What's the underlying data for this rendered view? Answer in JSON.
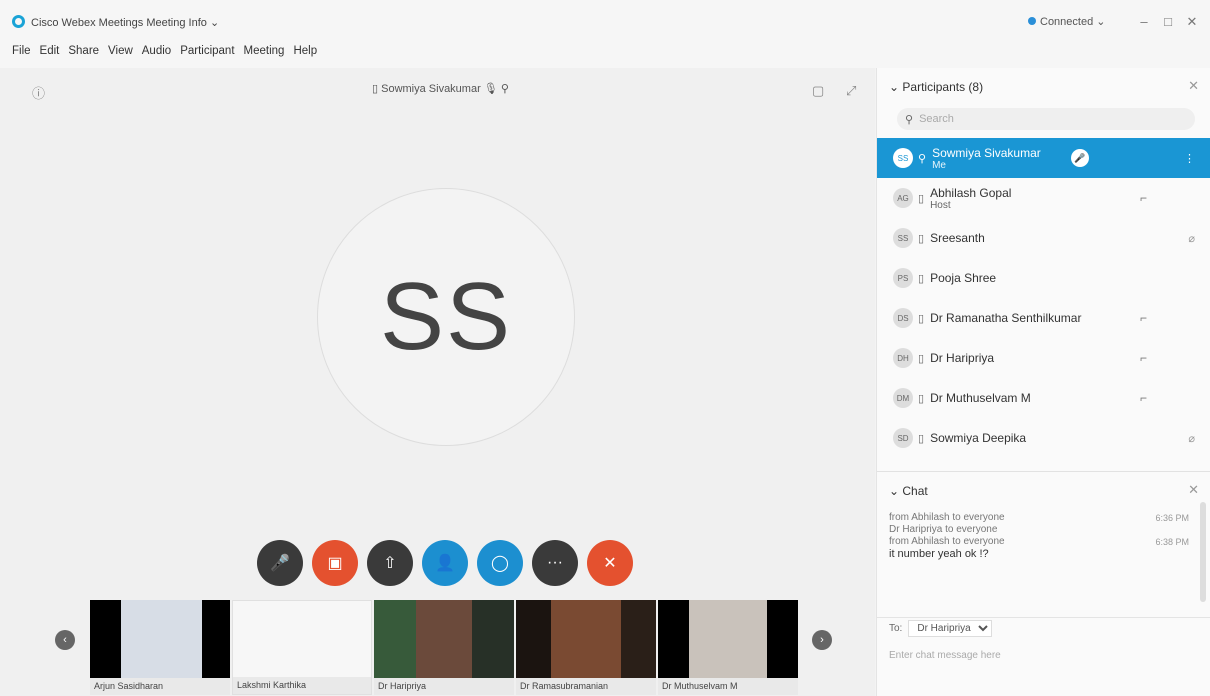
{
  "titlebar": {
    "app_title": "Cisco Webex Meetings    Meeting Info ⌄",
    "connected": "Connected ⌄"
  },
  "menu": [
    "File",
    "Edit",
    "Share",
    "View",
    "Audio",
    "Participant",
    "Meeting",
    "Help"
  ],
  "stage": {
    "speaker_name": "Sowmiya Sivakumar",
    "initials": "SS"
  },
  "controls": [
    {
      "name": "mute",
      "icon": "🎤",
      "color": "dark"
    },
    {
      "name": "stop-video",
      "icon": "■",
      "color": "red"
    },
    {
      "name": "share",
      "icon": "⇧",
      "color": "dark"
    },
    {
      "name": "participants",
      "icon": "👥",
      "color": "blue"
    },
    {
      "name": "chat",
      "icon": "💬",
      "color": "blue"
    },
    {
      "name": "more",
      "icon": "···",
      "color": "dark"
    },
    {
      "name": "leave",
      "icon": "✕",
      "color": "red"
    }
  ],
  "thumbnails": [
    {
      "label": "Arjun Sasidharan",
      "bg": "#2b2b2b"
    },
    {
      "label": "Lakshmi Karthika",
      "bg": "#f7f7f7"
    },
    {
      "label": "Dr Haripriya",
      "bg": "#3a4a3a"
    },
    {
      "label": "Dr Ramasubramanian",
      "bg": "#3a2a22"
    },
    {
      "label": "Dr Muthuselvam M",
      "bg": "#444"
    }
  ],
  "panel": {
    "title": "Participants (8)",
    "search_placeholder": "Search",
    "participants": [
      {
        "initials": "SS",
        "name": "Sowmiya Sivakumar",
        "sub": "Me",
        "active": true
      },
      {
        "initials": "AG",
        "name": "Abhilash Gopal",
        "sub": "Host",
        "active": false
      },
      {
        "initials": "SS",
        "name": "Sreesanth",
        "sub": "",
        "active": false
      },
      {
        "initials": "PS",
        "name": "Pooja Shree",
        "sub": "",
        "active": false
      },
      {
        "initials": "DS",
        "name": "Dr Ramanatha Senthilkumar",
        "sub": "",
        "active": false
      },
      {
        "initials": "DH",
        "name": "Dr Haripriya",
        "sub": "",
        "active": false
      },
      {
        "initials": "DM",
        "name": "Dr Muthuselvam M",
        "sub": "",
        "active": false
      },
      {
        "initials": "SD",
        "name": "Sowmiya Deepika",
        "sub": "",
        "active": false
      }
    ]
  },
  "chat": {
    "title": "Chat",
    "messages": [
      {
        "meta": "from Abhilash to everyone",
        "time": "6:36 PM",
        "body": ""
      },
      {
        "meta": "Dr Haripriya to everyone",
        "time": "",
        "body": ""
      },
      {
        "meta": "from Abhilash to everyone",
        "time": "6:38 PM",
        "body": "it number yeah ok !?"
      }
    ],
    "to_label": "To:",
    "to_value": "Dr Haripriya",
    "input_placeholder": "Enter chat message here"
  }
}
